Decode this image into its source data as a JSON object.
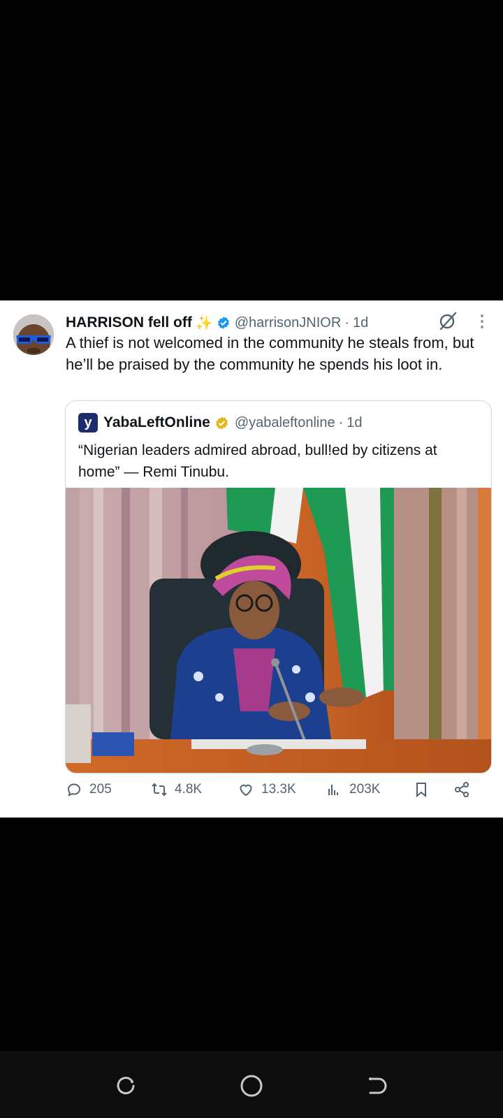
{
  "tweet": {
    "display_name": "HARRISON fell off",
    "handle": "@harrisonJNIOR",
    "separator": "·",
    "time": "1d",
    "text": "A thief is not welcomed in the community he steals from, but he’ll be praised by the community he spends his loot in.",
    "icons": [
      "sparkle-icon",
      "verified-badge-icon",
      "grok-icon",
      "more-icon"
    ]
  },
  "quote": {
    "logo_letter": "y",
    "display_name": "YabaLeftOnline",
    "handle": "@yabaleftonline",
    "separator": "·",
    "time": "1d",
    "text": "“Nigerian leaders admired abroad, bull!ed by citizens at home” — Remi Tinubu."
  },
  "actions": {
    "replies": "205",
    "reposts": "4.8K",
    "likes": "13.3K",
    "views": "203K"
  },
  "colors": {
    "text_primary": "#0f1419",
    "text_secondary": "#536471",
    "verified_blue": "#1d9bf0",
    "verified_gold": "#e2b719",
    "nigeria_green": "#1f9a55"
  },
  "system_nav": {
    "icons": [
      "recent-apps-icon",
      "home-icon",
      "back-icon"
    ]
  }
}
